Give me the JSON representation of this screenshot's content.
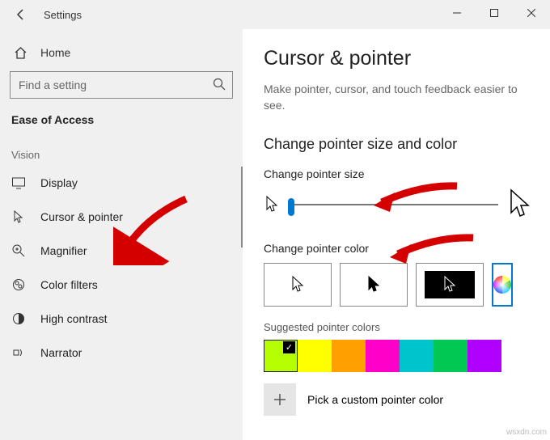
{
  "titlebar": {
    "title": "Settings"
  },
  "sidebar": {
    "home": "Home",
    "search_placeholder": "Find a setting",
    "category": "Ease of Access",
    "group": "Vision",
    "items": [
      {
        "label": "Display"
      },
      {
        "label": "Cursor & pointer"
      },
      {
        "label": "Magnifier"
      },
      {
        "label": "Color filters"
      },
      {
        "label": "High contrast"
      },
      {
        "label": "Narrator"
      }
    ]
  },
  "main": {
    "heading": "Cursor & pointer",
    "description": "Make pointer, cursor, and touch feedback easier to see.",
    "section_heading": "Change pointer size and color",
    "size_label": "Change pointer size",
    "color_label": "Change pointer color",
    "suggested_label": "Suggested pointer colors",
    "custom_label": "Pick a custom pointer color",
    "suggested_colors": [
      "#b6ff00",
      "#ffff00",
      "#ff9f00",
      "#ff00c8",
      "#00c4cc",
      "#00c853",
      "#b000ff"
    ]
  }
}
